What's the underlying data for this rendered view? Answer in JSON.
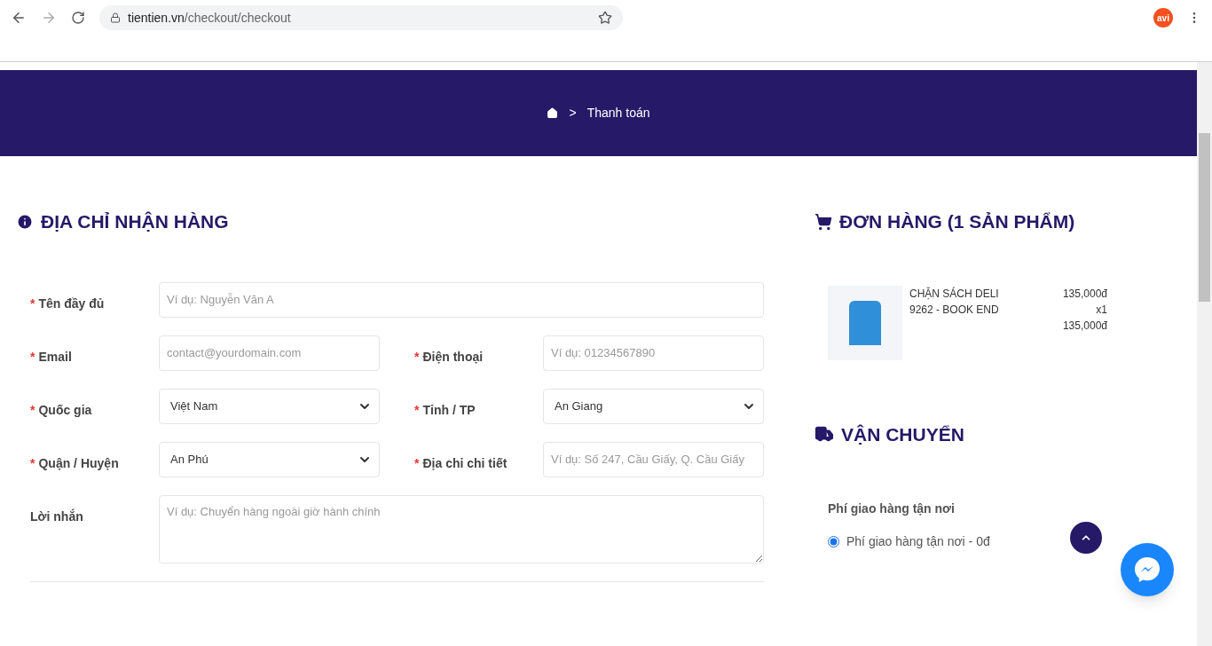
{
  "browser": {
    "url_host": "tientien.vn",
    "url_path": "/checkout/checkout",
    "profile": "avi"
  },
  "breadcrumb": {
    "current": "Thanh toán",
    "separator": ">"
  },
  "address": {
    "title": "ĐỊA CHỈ NHẬN HÀNG",
    "rows": [
      [
        {
          "label": "Tên đầy đủ",
          "required_mark": "*",
          "kind": "input",
          "placeholder": "Ví dụ: Nguyễn Văn A"
        }
      ],
      [
        {
          "label": "Email",
          "required_mark": "*",
          "kind": "input",
          "placeholder": "contact@yourdomain.com"
        },
        {
          "label": "Điện thoại",
          "required_mark": "*",
          "kind": "input",
          "placeholder": "Ví dụ: 01234567890"
        }
      ],
      [
        {
          "label": "Quốc gia",
          "required_mark": "*",
          "kind": "select",
          "value": "Việt Nam"
        },
        {
          "label": "Tỉnh / TP",
          "required_mark": "*",
          "kind": "select",
          "value": "An Giang"
        }
      ],
      [
        {
          "label": "Quận / Huyện",
          "required_mark": "*",
          "kind": "select",
          "value": "An Phú"
        },
        {
          "label": "Địa chỉ chi tiết",
          "required_mark": "*",
          "kind": "input",
          "placeholder": "Ví dụ: Số 247, Cầu Giấy, Q. Cầu Giấy"
        }
      ],
      [
        {
          "label": "Lời nhắn",
          "kind": "textarea",
          "placeholder": "Ví dụ: Chuyển hàng ngoài giờ hành chính"
        }
      ]
    ]
  },
  "order": {
    "title": "ĐƠN HÀNG (1 SẢN PHẨM)",
    "items": [
      {
        "name": "CHẶN SÁCH DELI 9262 - BOOK END",
        "price": "135,000đ",
        "quantity": "x1",
        "total": "135,000đ"
      }
    ]
  },
  "shipping": {
    "title": "VẬN CHUYỂN",
    "group_label": "Phí giao hàng tận nơi",
    "options": [
      {
        "label": "Phí giao hàng tận nơi - 0đ",
        "selected": true
      }
    ]
  }
}
